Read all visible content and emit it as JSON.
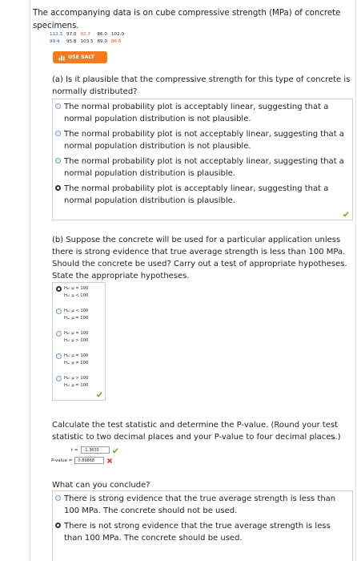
{
  "intro": {
    "text": "The accompanying data is on cube compressive strength (MPa) of concrete specimens."
  },
  "data_table": {
    "row1": [
      "112.3",
      "97.0",
      "92.7",
      "86.0",
      "102.0"
    ],
    "row2": [
      "99.4",
      "95.8",
      "103.5",
      "89.0",
      "86.6"
    ]
  },
  "salt_button": {
    "label": "USE SALT",
    "icon": "chart-icon"
  },
  "part_a": {
    "question": "(a) Is it plausible that the compressive strength for this type of concrete is normally distributed?",
    "options": [
      "The normal probability plot is acceptably linear, suggesting that a normal population distribution is not plausible.",
      "The normal probability plot is not acceptably linear, suggesting that a normal population distribution is not plausible.",
      "The normal probability plot is not acceptably linear, suggesting that a normal population distribution is plausible.",
      "The normal probability plot is acceptably linear, suggesting that a normal population distribution is plausible."
    ],
    "selected_index": 3,
    "status": "correct"
  },
  "part_b": {
    "question": "(b) Suppose the concrete will be used for a particular application unless there is strong evidence that true average strength is less than 100 MPa. Should the concrete be used? Carry out a test of appropriate hypotheses. State the appropriate hypotheses.",
    "hypotheses": [
      {
        "h0": "H₀: μ = 100",
        "ha": "Hₐ: μ < 100"
      },
      {
        "h0": "H₀: μ < 100",
        "ha": "Hₐ: μ = 100"
      },
      {
        "h0": "H₀: μ = 100",
        "ha": "Hₐ: μ > 100"
      },
      {
        "h0": "H₀: μ = 100",
        "ha": "Hₐ: μ ≠ 100"
      },
      {
        "h0": "H₀: μ > 100",
        "ha": "Hₐ: μ = 100"
      }
    ],
    "selected_index": 0,
    "status": "correct"
  },
  "test_stat": {
    "question": "Calculate the test statistic and determine the P-value. (Round your test statistic to two decimal places and your P-value to four decimal places.)",
    "t_label": "t =",
    "t_value": "-1.3635",
    "t_status": "correct",
    "p_label": "P-value =",
    "p_value": "0.89868",
    "p_status": "incorrect"
  },
  "conclusion": {
    "question": "What can you conclude?",
    "options": [
      "There is strong evidence that the true average strength is less than 100 MPa. The concrete should not be used.",
      "There is not strong evidence that the true average strength is less than 100 MPa. The concrete should be used."
    ],
    "selected_index": 1
  },
  "colors": {
    "accent": "#f47a20",
    "correct": "#6cab3a",
    "incorrect": "#d43c2e",
    "highlight_value": "#d9542c"
  }
}
